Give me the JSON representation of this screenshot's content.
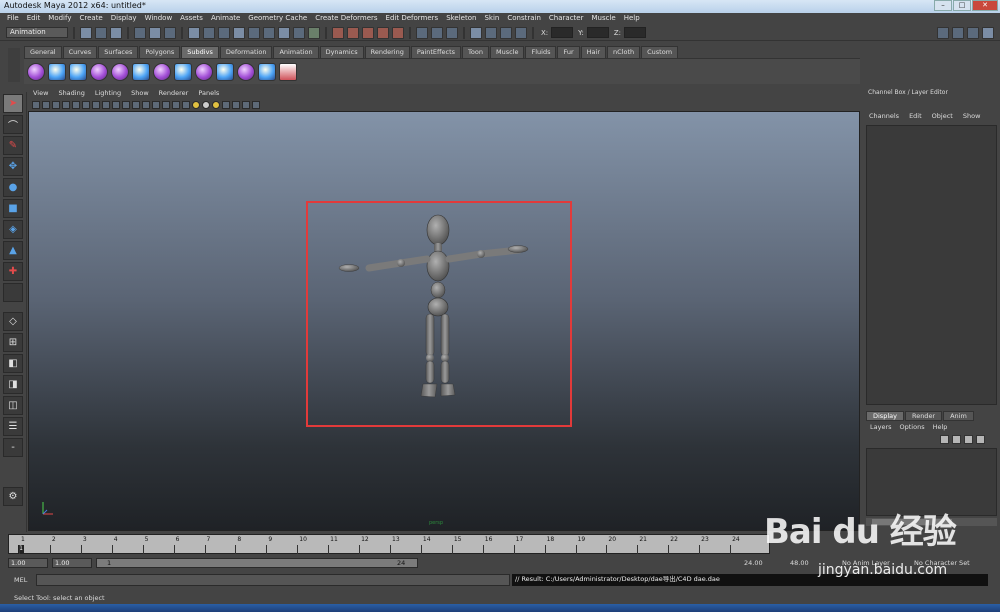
{
  "window": {
    "title": "Autodesk Maya 2012 x64: untitled*"
  },
  "menubar": [
    "File",
    "Edit",
    "Modify",
    "Create",
    "Display",
    "Window",
    "Assets",
    "Animate",
    "Geometry Cache",
    "Create Deformers",
    "Edit Deformers",
    "Skeleton",
    "Skin",
    "Constrain",
    "Character",
    "Muscle",
    "Help"
  ],
  "statusline": {
    "mode": "Animation",
    "x_label": "X:",
    "y_label": "Y:",
    "z_label": "Z:"
  },
  "shelf": {
    "tabs": [
      "General",
      "Curves",
      "Surfaces",
      "Polygons",
      "Subdivs",
      "Deformation",
      "Animation",
      "Dynamics",
      "Rendering",
      "PaintEffects",
      "Toon",
      "Muscle",
      "Fluids",
      "Fur",
      "Hair",
      "nCloth",
      "Custom"
    ],
    "active_tab": "Subdivs"
  },
  "panel": {
    "menu": [
      "View",
      "Shading",
      "Lighting",
      "Show",
      "Renderer",
      "Panels"
    ],
    "camera_label": "persp"
  },
  "channel_box": {
    "title": "Channel Box / Layer Editor",
    "menu": [
      "Channels",
      "Edit",
      "Object",
      "Show"
    ]
  },
  "layer_editor": {
    "tabs": [
      "Display",
      "Render",
      "Anim"
    ],
    "active_tab": "Display",
    "menu": [
      "Layers",
      "Options",
      "Help"
    ]
  },
  "timeline": {
    "ticks": [
      "1",
      "2",
      "3",
      "4",
      "5",
      "6",
      "7",
      "8",
      "9",
      "10",
      "11",
      "12",
      "13",
      "14",
      "15",
      "16",
      "17",
      "18",
      "19",
      "20",
      "21",
      "22",
      "23",
      "24"
    ],
    "current_frame": "1"
  },
  "range_slider": {
    "start": "1.00",
    "playback_start": "1.00",
    "bar_start": "1",
    "bar_end": "24",
    "playback_end": "24.00",
    "end": "48.00",
    "anim_layer": "No Anim Layer",
    "character_set": "No Character Set"
  },
  "command_line": {
    "label": "MEL",
    "result": "// Result: C:/Users/Administrator/Desktop/dae导出/C4D dae.dae"
  },
  "help_line": "Select Tool: select an object",
  "watermark": {
    "logo": "Bai du 经验",
    "url": "jingyan.baidu.com"
  },
  "colors": {
    "highlight": "#e23a3a",
    "viewport_top": "#8393a8",
    "viewport_bottom": "#1f2226"
  }
}
